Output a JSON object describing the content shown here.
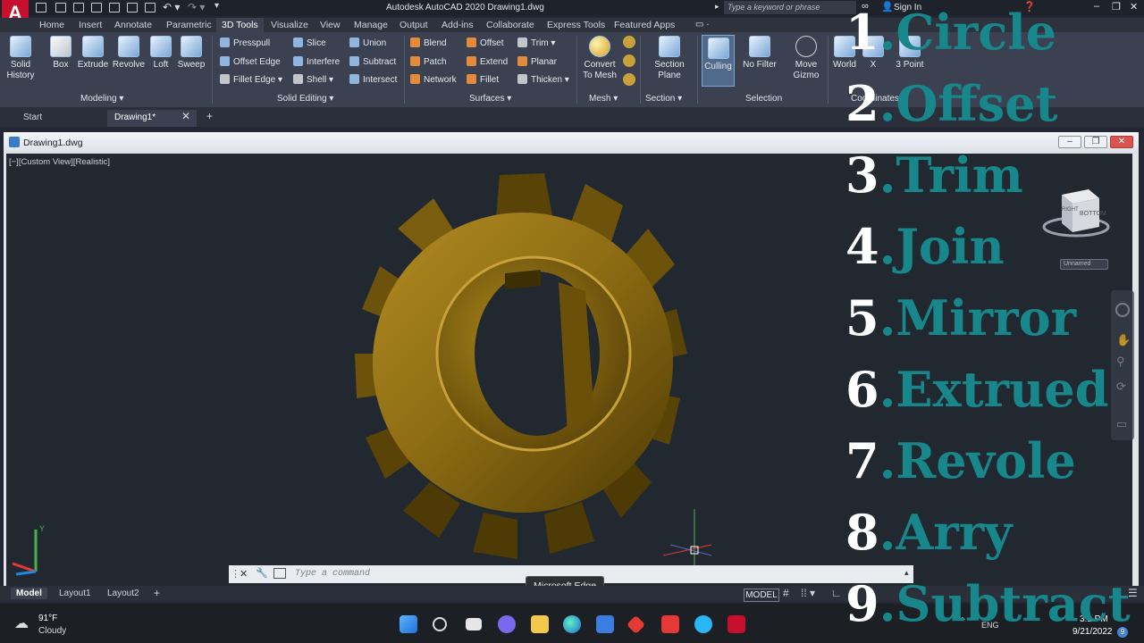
{
  "title_bar": {
    "app_logo": "A",
    "app_title": "Autodesk AutoCAD 2020    Drawing1.dwg",
    "search_placeholder": "Type a keyword or phrase",
    "signin": "Sign In"
  },
  "menu_tabs": [
    "Home",
    "Insert",
    "Annotate",
    "Parametric",
    "3D Tools",
    "Visualize",
    "View",
    "Manage",
    "Output",
    "Add-ins",
    "Collaborate",
    "Express Tools",
    "Featured Apps"
  ],
  "active_tab": "3D Tools",
  "ribbon": {
    "modeling": {
      "title": "Modeling ▾",
      "buttons": [
        "Solid History",
        "Box",
        "Extrude",
        "Revolve",
        "Loft",
        "Sweep"
      ]
    },
    "solid_editing": {
      "title": "Solid Editing ▾",
      "col1": [
        "Presspull",
        "Offset Edge",
        "Fillet Edge ▾"
      ],
      "col2": [
        "Slice",
        "Interfere",
        "Shell ▾"
      ],
      "col3": [
        "Union",
        "Subtract",
        "Intersect"
      ]
    },
    "surfaces": {
      "title": "Surfaces ▾",
      "col1": [
        "Blend",
        "Patch",
        "Network"
      ],
      "col2": [
        "Offset",
        "Extend",
        "Fillet"
      ],
      "col3": [
        "Trim ▾",
        "Planar",
        "Thicken ▾"
      ]
    },
    "mesh": {
      "title": "Mesh ▾",
      "button": "Convert To Mesh"
    },
    "section": {
      "title": "Section ▾",
      "button": "Section Plane"
    },
    "selection": {
      "title": "Selection",
      "buttons": [
        "Culling",
        "No Filter",
        "Move Gizmo"
      ]
    },
    "coordinates": {
      "title": "Coordinates",
      "buttons": [
        "World",
        "X",
        "3 Point"
      ]
    }
  },
  "doc_tabs": [
    "Start",
    "Drawing1*"
  ],
  "drawing": {
    "window_title": "Drawing1.dwg",
    "view_label": "[−][Custom View][Realistic]",
    "viewcube_label": "BOTTOM",
    "viewcube_side": "RIGHT",
    "unnamed": "Unnamed"
  },
  "command": {
    "placeholder": "Type a command"
  },
  "layout_tabs": [
    "Model",
    "Layout1",
    "Layout2"
  ],
  "status": {
    "model": "MODEL"
  },
  "tooltip": "Microsoft Edge",
  "taskbar": {
    "weather_temp": "91°F",
    "weather_desc": "Cloudy",
    "lang": "ENG",
    "time": "3:1 PM",
    "date": "9/21/2022",
    "notif": "9"
  },
  "overlay": [
    {
      "num": "1",
      "text": ".Circle"
    },
    {
      "num": "2",
      "text": ".Offset"
    },
    {
      "num": "3",
      "text": ".Trim"
    },
    {
      "num": "4",
      "text": ".Join"
    },
    {
      "num": "5",
      "text": ".Mirror"
    },
    {
      "num": "6",
      "text": ".Extrued"
    },
    {
      "num": "7",
      "text": ".Revole"
    },
    {
      "num": "8",
      "text": ".Arry"
    },
    {
      "num": "9",
      "text": ".Subtract"
    }
  ],
  "colors": {
    "overlay_text": "#17878c",
    "gear": "#8a6a12"
  }
}
